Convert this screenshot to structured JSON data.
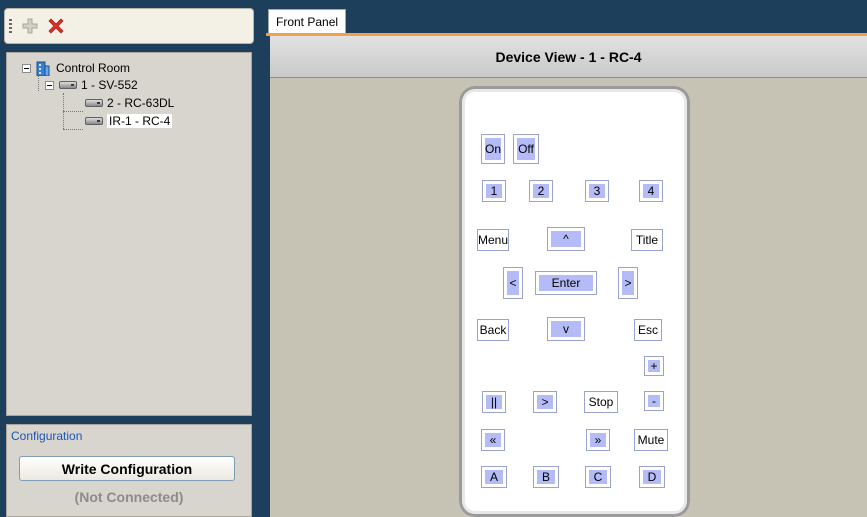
{
  "toolbar": {
    "add_icon": "plus-icon",
    "delete_icon": "red-x-icon"
  },
  "tree": {
    "root": "Control Room",
    "server": "1 - SV-552",
    "children": [
      "2 - RC-63DL",
      "IR-1 - RC-4"
    ],
    "selected": "IR-1 - RC-4"
  },
  "config": {
    "title": "Configuration",
    "write_label": "Write Configuration",
    "status": "(Not Connected)"
  },
  "tabs": [
    "Front Panel"
  ],
  "device_view": {
    "title": "Device View - 1 - RC-4"
  },
  "remote": {
    "on": "On",
    "off": "Off",
    "num1": "1",
    "num2": "2",
    "num3": "3",
    "num4": "4",
    "menu": "Menu",
    "up": "^",
    "title": "Title",
    "left": "<",
    "enter": "Enter",
    "right": ">",
    "back": "Back",
    "down": "v",
    "esc": "Esc",
    "vol_up": "+",
    "pause": "||",
    "play": ">",
    "stop": "Stop",
    "vol_down": "-",
    "rewind": "«",
    "fast_forward": "»",
    "mute": "Mute",
    "a": "A",
    "b": "B",
    "c": "C",
    "d": "D"
  },
  "colors": {
    "accent_tab_line": "#f2a04a",
    "remote_button": "#b4bbf6",
    "sidebar_bg": "#1e3f5c"
  }
}
